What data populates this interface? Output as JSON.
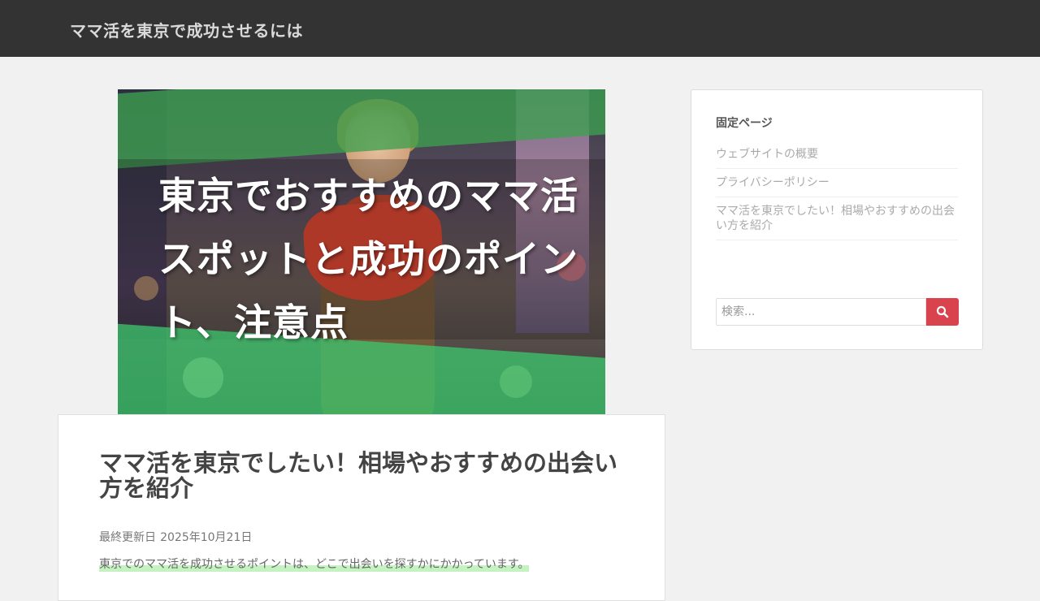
{
  "header": {
    "site_title": "ママ活を東京で成功させるには"
  },
  "hero": {
    "overlay_text_lines": [
      "東京でおすすめのママ活",
      "スポットと成功のポイン",
      "ト、注意点"
    ]
  },
  "article": {
    "title": "ママ活を東京でしたい！相場やおすすめの出会い方を紹介",
    "updated_label": "最終更新日",
    "updated_date": "2025年10月21日",
    "lead": "東京でのママ活を成功させるポイントは、どこで出会いを探すかにかかっています。"
  },
  "sidebar": {
    "widget_title": "固定ページ",
    "pages": [
      {
        "label": "ウェブサイトの概要"
      },
      {
        "label": "プライバシーポリシー"
      },
      {
        "label": "ママ活を東京でしたい！相場やおすすめの出会い方を紹介"
      }
    ],
    "search": {
      "placeholder": "検索...",
      "button_icon": "search-icon"
    }
  },
  "colors": {
    "topbar": "#333333",
    "accent": "#d9434e",
    "highlight": "#c5f2c1"
  }
}
